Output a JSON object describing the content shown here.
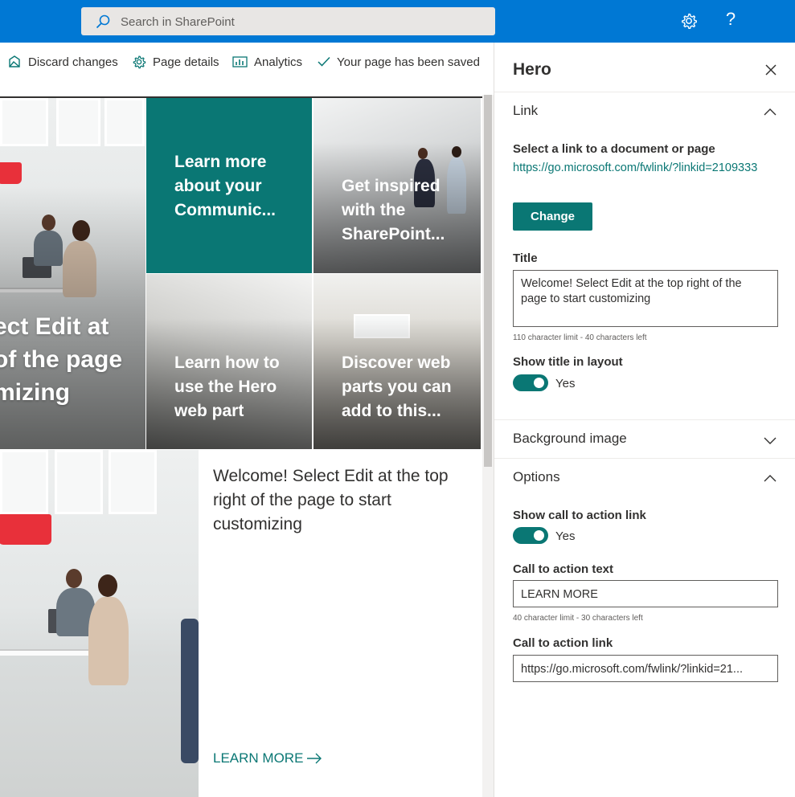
{
  "suitebar": {
    "search_placeholder": "Search in SharePoint",
    "icons": [
      "search-icon",
      "gear-icon",
      "help-icon"
    ],
    "help_glyph": "?",
    "brand_color": "#0078d4"
  },
  "command_bar": {
    "discard_label": "Discard changes",
    "page_details_label": "Page details",
    "analytics_label": "Analytics",
    "saved_status": "Your page has been saved"
  },
  "canvas": {
    "hero_title": "ect Edit at\nof the page\nmizing",
    "tiles": [
      {
        "title": "Learn more about your Communic..."
      },
      {
        "title": "Get inspired with the SharePoint..."
      },
      {
        "title": "Learn how to use the Hero web part"
      },
      {
        "title": "Discover web parts you can add to this..."
      }
    ],
    "featured": {
      "title": "Welcome! Select Edit at the top right of the page to start customizing",
      "cta": "LEARN MORE"
    },
    "accent_color": "#0a7774"
  },
  "pane": {
    "title": "Hero",
    "link_group": {
      "header": "Link",
      "select_label": "Select a link to a document or page",
      "url": "https://go.microsoft.com/fwlink/?linkid=2109333",
      "change_button": "Change",
      "title_label": "Title",
      "title_value": "Welcome! Select Edit at the top right of the page to start customizing",
      "title_hint": "110 character limit - 40 characters left",
      "show_title_label": "Show title in layout",
      "show_title_value": "Yes"
    },
    "background_group": {
      "header": "Background image"
    },
    "options_group": {
      "header": "Options",
      "cta_toggle_label": "Show call to action link",
      "cta_toggle_value": "Yes",
      "cta_text_label": "Call to action text",
      "cta_text_value": "LEARN MORE",
      "cta_text_hint": "40 character limit - 30 characters left",
      "cta_link_label": "Call to action link",
      "cta_link_value": "https://go.microsoft.com/fwlink/?linkid=21..."
    }
  }
}
